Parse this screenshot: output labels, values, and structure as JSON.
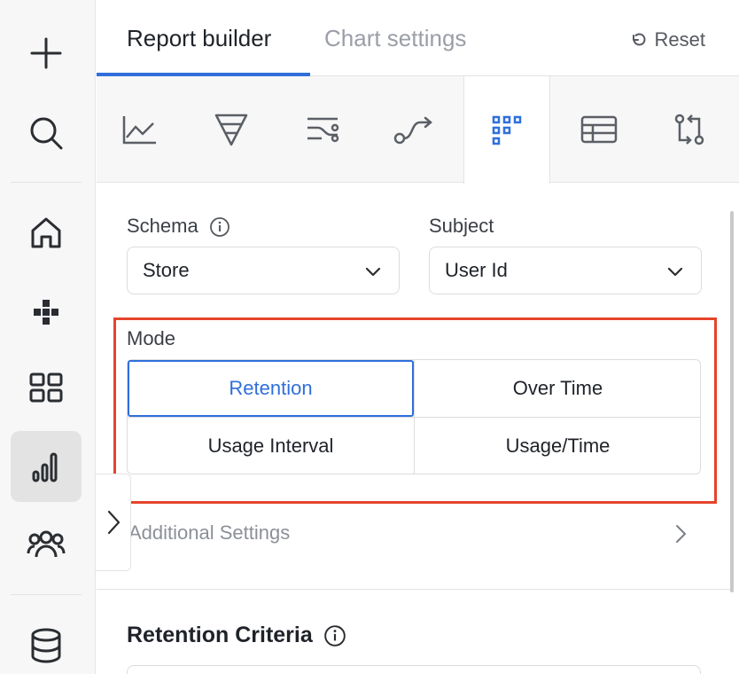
{
  "tabs": {
    "report_builder": "Report builder",
    "chart_settings": "Chart settings",
    "reset": "Reset"
  },
  "chart_types": [
    "line-chart-icon",
    "funnel-icon",
    "flows-icon",
    "journey-icon",
    "retention-grid-icon",
    "table-icon",
    "compare-icon"
  ],
  "form": {
    "schema_label": "Schema",
    "schema_value": "Store",
    "subject_label": "Subject",
    "subject_value": "User Id"
  },
  "mode": {
    "label": "Mode",
    "options": [
      "Retention",
      "Over Time",
      "Usage Interval",
      "Usage/Time"
    ],
    "selected": "Retention"
  },
  "additional_settings": "Additional Settings",
  "retention_criteria": "Retention Criteria",
  "colors": {
    "accent": "#2f6fdc",
    "highlight": "#e5442c"
  }
}
